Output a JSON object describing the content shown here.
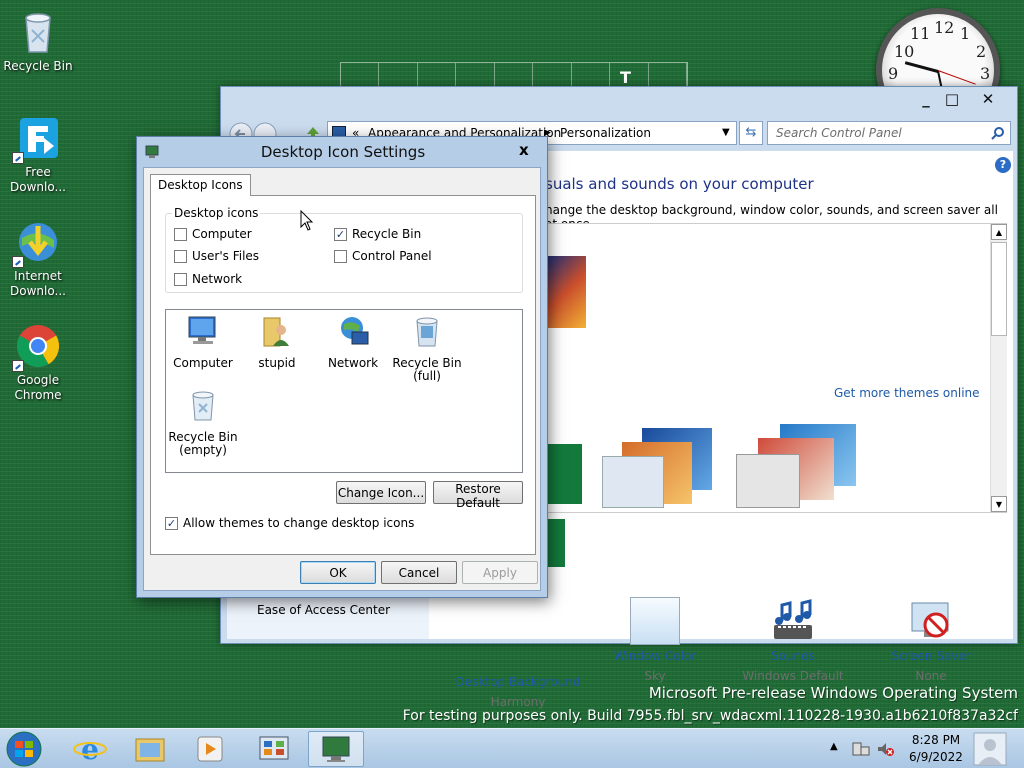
{
  "desktop": {
    "icons": [
      {
        "label": "Recycle Bin",
        "icon": "recycle-bin-icon"
      },
      {
        "label": "Free Downlo...",
        "icon": "free-download-manager-icon"
      },
      {
        "label": "Internet Downlo...",
        "icon": "internet-download-manager-icon"
      },
      {
        "label": "Google Chrome",
        "icon": "chrome-icon"
      }
    ],
    "clock_numbers": [
      "12",
      "1",
      "2",
      "3",
      "9",
      "10",
      "11"
    ],
    "grid_gadget_letter": "T",
    "watermark": {
      "line1": "Microsoft Pre-release Windows Operating System",
      "line2": "For testing purposes only. Build 7955.fbl_srv_wdacxml.110228-1930.a1b6210f837a32cf"
    }
  },
  "control_panel": {
    "address": {
      "chevron": "«",
      "crumb1": "Appearance and Personalization",
      "crumb2": "Personalization"
    },
    "search_placeholder": "Search Control Panel",
    "heading": "sonalize the visuals and sounds on your computer",
    "heading_visible": "suals and sounds on your computer",
    "description": "hange the desktop background, window color, sounds, and screen saver all at once.",
    "more_themes_link": "Get more themes online",
    "left_link": "Ease of Access Center",
    "bottom_items": [
      {
        "title": "Desktop Background",
        "sub": "Harmony",
        "icon": "desktop-background-icon"
      },
      {
        "title": "Window Color",
        "sub": "Sky",
        "icon": "window-color-icon"
      },
      {
        "title": "Sounds",
        "sub": "Windows Default",
        "icon": "sounds-icon"
      },
      {
        "title": "Screen Saver",
        "sub": "None",
        "icon": "screen-saver-icon"
      }
    ]
  },
  "dialog": {
    "title": "Desktop Icon Settings",
    "close": "x",
    "tab": "Desktop Icons",
    "group_label": "Desktop icons",
    "checkboxes": [
      {
        "label": "Computer",
        "checked": false
      },
      {
        "label": "Recycle Bin",
        "checked": true
      },
      {
        "label": "User's Files",
        "checked": false
      },
      {
        "label": "Control Panel",
        "checked": false
      },
      {
        "label": "Network",
        "checked": false
      }
    ],
    "icon_list": [
      {
        "label": "Computer",
        "icon": "computer-icon"
      },
      {
        "label": "stupid",
        "icon": "user-folder-icon"
      },
      {
        "label": "Network",
        "icon": "network-icon"
      },
      {
        "label": "Recycle Bin (full)",
        "icon": "recycle-bin-full-icon"
      },
      {
        "label": "Recycle Bin (empty)",
        "icon": "recycle-bin-empty-icon"
      }
    ],
    "change_icon": "Change Icon...",
    "restore_default": "Restore Default",
    "allow_themes": "Allow themes to change desktop icons",
    "allow_themes_checked": true,
    "ok": "OK",
    "cancel": "Cancel",
    "apply": "Apply"
  },
  "taskbar": {
    "time": "8:28 PM",
    "date": "6/9/2022"
  }
}
